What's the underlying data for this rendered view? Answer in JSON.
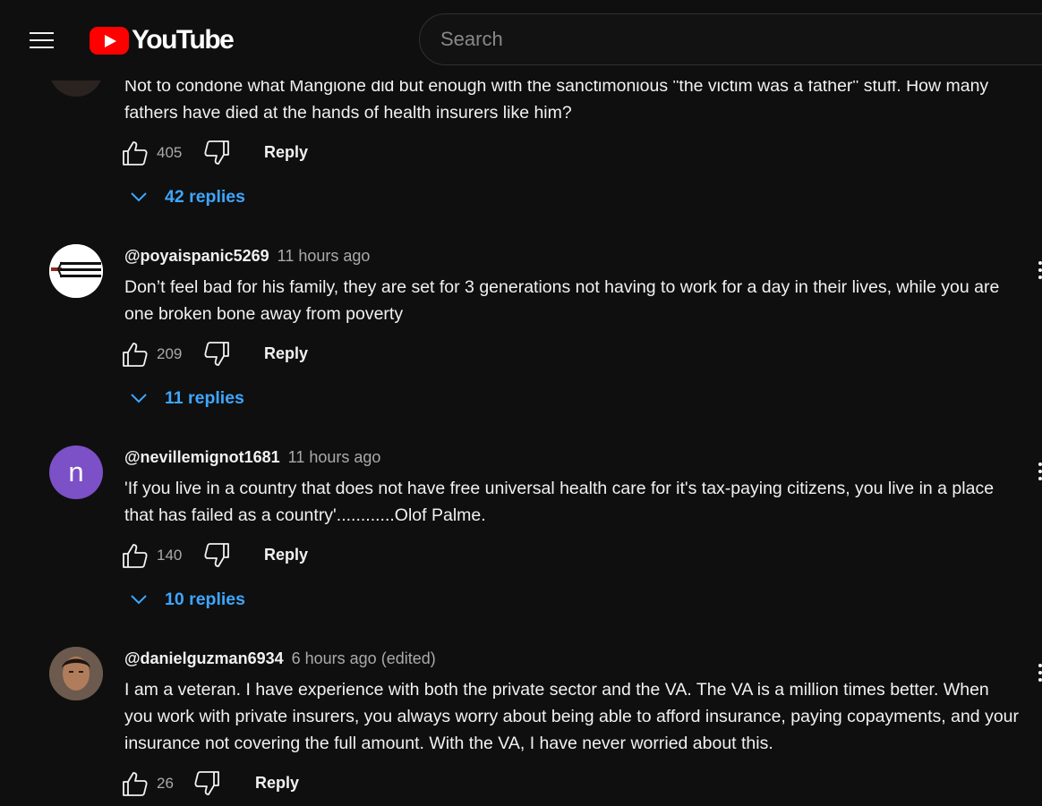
{
  "header": {
    "logo_text": "YouTube",
    "search_placeholder": "Search"
  },
  "colors": {
    "link": "#3ea6ff",
    "brand_red": "#ff0000",
    "background": "#0f0f0f"
  },
  "comments": [
    {
      "text": "Not to condone what Mangione did but enough with the sanctimonious \"the victim was a father\" stuff. How many fathers have died at the hands of health insurers like him?",
      "likes": "405",
      "reply_label": "Reply",
      "replies_label": "42 replies"
    },
    {
      "author": "@poyaispanic5269",
      "time": "11 hours ago",
      "text": "Don’t feel bad for his family, they are set for 3 generations not having to work for a day in their lives, while you are one broken bone away from poverty",
      "likes": "209",
      "reply_label": "Reply",
      "replies_label": "11 replies"
    },
    {
      "author": "@nevillemignot1681",
      "time": "11 hours ago",
      "avatar_letter": "n",
      "text": "'If you live in a country that does not have free universal health care for it's tax-paying citizens, you live in a place that has failed as a country'............Olof Palme.",
      "likes": "140",
      "reply_label": "Reply",
      "replies_label": "10 replies"
    },
    {
      "author": "@danielguzman6934",
      "time": "6 hours ago (edited)",
      "text": "I am a veteran. I have experience with both the private sector and the VA. The VA is a million times better. When you work with private insurers, you always worry about being able to afford insurance, paying copayments, and your insurance not covering the full amount. With the VA, I have never worried about this.",
      "likes": "26",
      "reply_label": "Reply"
    }
  ]
}
